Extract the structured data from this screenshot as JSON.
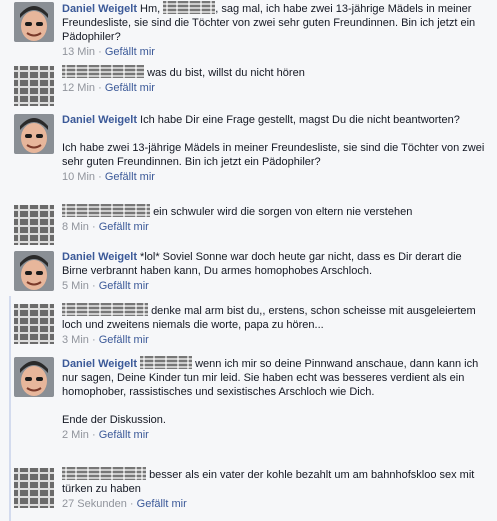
{
  "comments": [
    {
      "author": "Daniel Weigelt",
      "text": "Hm, ___, sag mal, ich habe zwei 13-jährige Mädels in meiner Freundesliste, sie sind die Töchter von zwei sehr guten Freundinnen. Bin ich jetzt ein Pädophiler?",
      "pre": "Hm, ",
      "post": ", sag mal, ich habe zwei 13-jährige Mädels in meiner Freundesliste, sie sind die Töchter von zwei sehr guten Freundinnen. Bin ich jetzt ein Pädophiler?",
      "time": "13 Min",
      "like": "Gefällt mir"
    },
    {
      "author": "",
      "text": "was du bist, willst du nicht hören",
      "time": "12 Min",
      "like": "Gefällt mir"
    },
    {
      "author": "Daniel Weigelt",
      "text": "Ich habe Dir eine Frage gestellt, magst Du die nicht beantworten?",
      "text2": "Ich habe zwei 13-jährige Mädels in meiner Freundesliste, sie sind die Töchter von zwei sehr guten Freundinnen. Bin ich jetzt ein Pädophiler?",
      "time": "10 Min",
      "like": "Gefällt mir"
    },
    {
      "author": "",
      "text": "ein schwuler wird die sorgen von eltern nie verstehen",
      "time": "8 Min",
      "like": "Gefällt mir"
    },
    {
      "author": "Daniel Weigelt",
      "text": "*lol* Soviel Sonne war doch heute gar nicht, dass es Dir derart die Birne verbrannt haben kann, Du armes homophobes Arschloch.",
      "time": "5 Min",
      "like": "Gefällt mir"
    },
    {
      "author": "",
      "text": "denke mal arm bist du,, erstens, schon scheisse mit ausgeleiertem loch und zweitens niemals die worte, papa zu hören...",
      "time": "3 Min",
      "like": "Gefällt mir"
    },
    {
      "author": "Daniel Weigelt",
      "text": "wenn ich mir so deine Pinnwand anschaue, dann kann ich nur sagen, Deine Kinder tun mir leid. Sie haben echt was besseres verdient als ein homophober, rassistisches und sexistisches Arschloch wie Dich.",
      "text2": "Ende der Diskussion.",
      "time": "2 Min",
      "like": "Gefällt mir"
    },
    {
      "author": "",
      "text": "besser als ein vater der kohle bezahlt um am bahnhofskloo sex mit türken zu haben",
      "time": "27 Sekunden",
      "like": "Gefällt mir"
    }
  ],
  "meta_separator": "·"
}
